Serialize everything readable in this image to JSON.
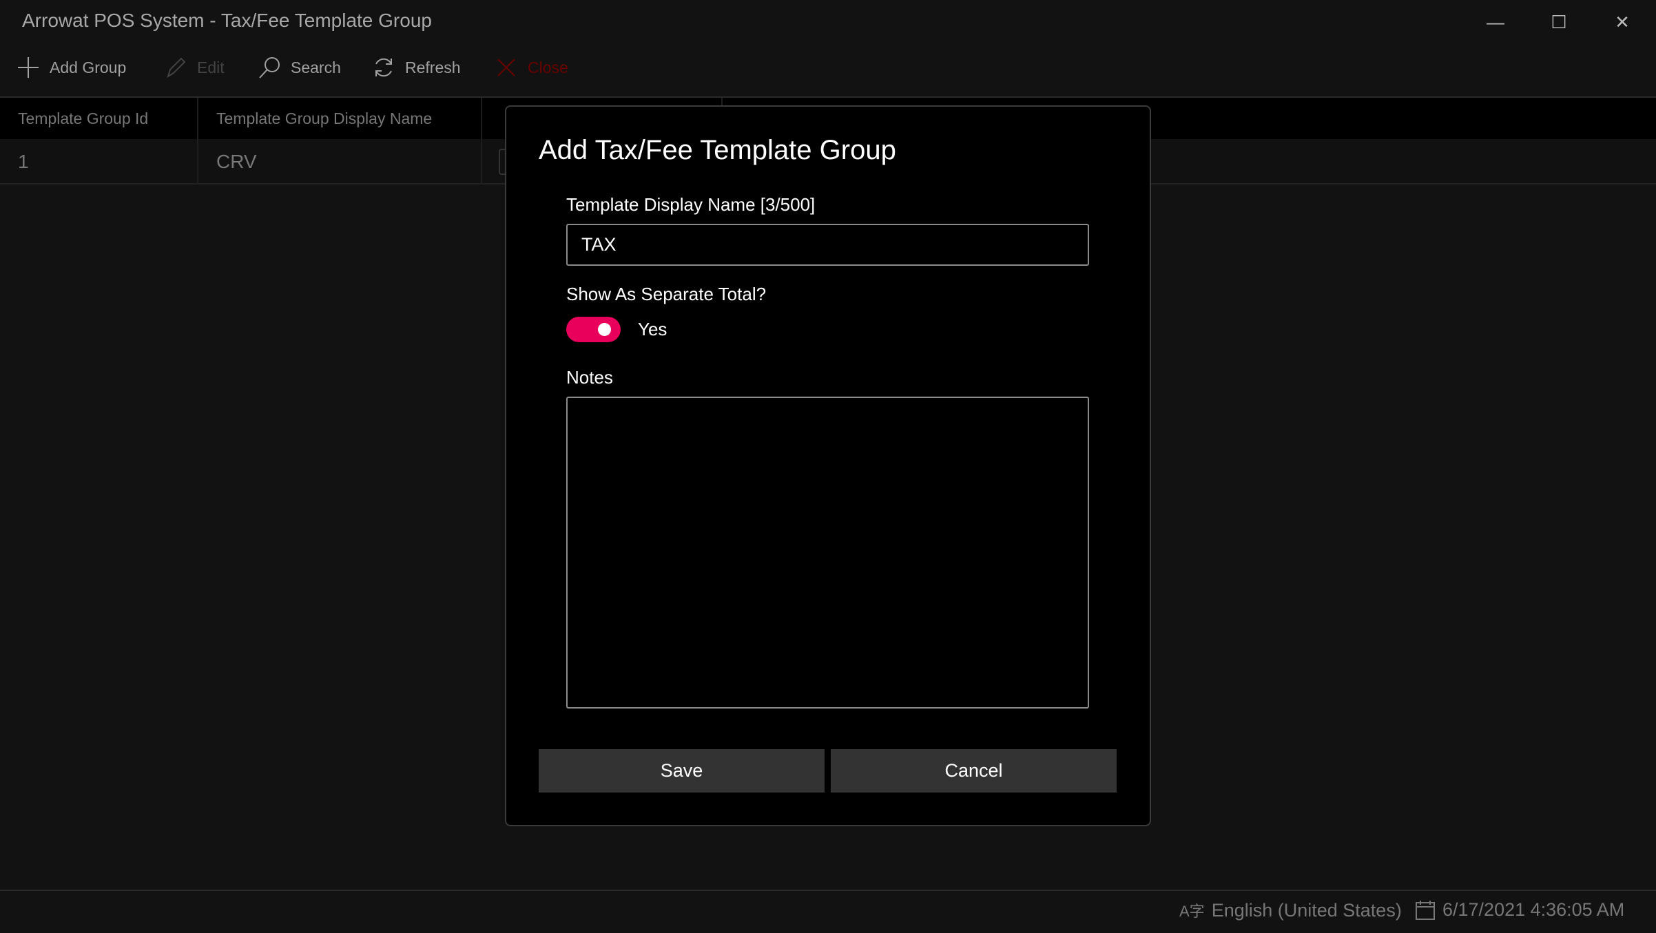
{
  "window": {
    "title": "Arrowat POS System - Tax/Fee Template Group"
  },
  "toolbar": {
    "add_group": "Add Group",
    "edit": "Edit",
    "search": "Search",
    "refresh": "Refresh",
    "close": "Close"
  },
  "grid": {
    "columns": [
      "Template Group Id",
      "Template Group Display Name"
    ],
    "rows": [
      {
        "id": "1",
        "name": "CRV",
        "separate_total_checked": false
      }
    ]
  },
  "dialog": {
    "title": "Add Tax/Fee Template Group",
    "name_label": "Template Display Name [3/500]",
    "name_value": "TAX",
    "separate_label": "Show As Separate Total?",
    "separate_on": true,
    "separate_state": "Yes",
    "notes_label": "Notes",
    "notes_value": "",
    "save": "Save",
    "cancel": "Cancel",
    "accent": "#e8005a"
  },
  "status": {
    "language": "English (United States)",
    "datetime": "6/17/2021 4:36:05 AM"
  }
}
